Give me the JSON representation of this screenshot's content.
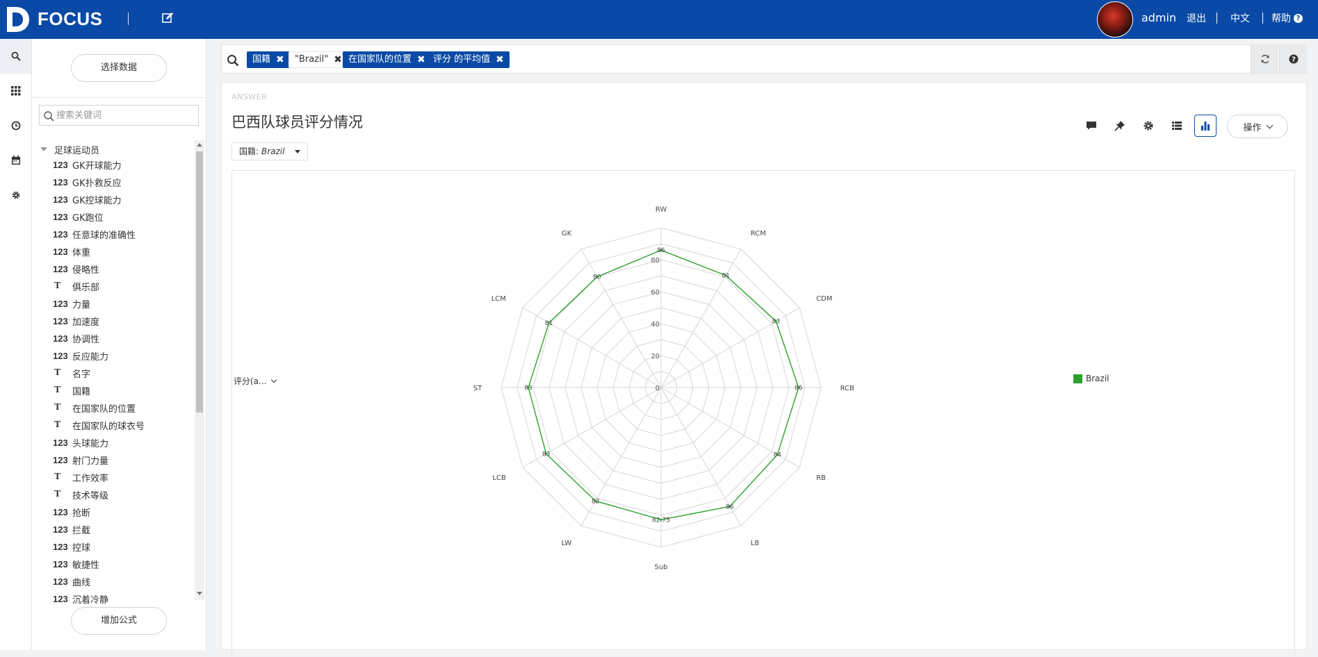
{
  "header": {
    "logo_text": "FOCUS",
    "user_name": "admin",
    "logout_label": "退出",
    "language_label": "中文",
    "help_label": "帮助",
    "help_glyph": "?"
  },
  "rail": {
    "items": [
      {
        "name": "search-icon",
        "active": true
      },
      {
        "name": "apps-icon",
        "active": false
      },
      {
        "name": "history-icon",
        "active": false
      },
      {
        "name": "calendar-icon",
        "active": false
      },
      {
        "name": "gear-icon",
        "active": false
      }
    ]
  },
  "data_panel": {
    "select_data_label": "选择数据",
    "search_placeholder": "搜索关键词",
    "table_name": "足球运动员",
    "fields": [
      {
        "type": "123",
        "name": "GK开球能力"
      },
      {
        "type": "123",
        "name": "GK扑救反应"
      },
      {
        "type": "123",
        "name": "GK控球能力"
      },
      {
        "type": "123",
        "name": "GK跑位"
      },
      {
        "type": "123",
        "name": "任意球的准确性"
      },
      {
        "type": "123",
        "name": "体重"
      },
      {
        "type": "123",
        "name": "侵略性"
      },
      {
        "type": "T",
        "name": "俱乐部"
      },
      {
        "type": "123",
        "name": "力量"
      },
      {
        "type": "123",
        "name": "加速度"
      },
      {
        "type": "123",
        "name": "协调性"
      },
      {
        "type": "123",
        "name": "反应能力"
      },
      {
        "type": "T",
        "name": "名字"
      },
      {
        "type": "T",
        "name": "国籍"
      },
      {
        "type": "T",
        "name": "在国家队的位置"
      },
      {
        "type": "T",
        "name": "在国家队的球衣号"
      },
      {
        "type": "123",
        "name": "头球能力"
      },
      {
        "type": "123",
        "name": "射门力量"
      },
      {
        "type": "T",
        "name": "工作效率"
      },
      {
        "type": "T",
        "name": "技术等级"
      },
      {
        "type": "123",
        "name": "抢断"
      },
      {
        "type": "123",
        "name": "拦截"
      },
      {
        "type": "123",
        "name": "控球"
      },
      {
        "type": "123",
        "name": "敏捷性"
      },
      {
        "type": "123",
        "name": "曲线"
      },
      {
        "type": "123",
        "name": "沉着冷静"
      }
    ],
    "add_formula_label": "增加公式"
  },
  "search_bar": {
    "tokens": [
      {
        "label": "国籍",
        "style": "blue"
      },
      {
        "label": "\"Brazil\"",
        "style": "plain"
      },
      {
        "label": "在国家队的位置",
        "style": "blue"
      },
      {
        "label": "评分 的平均值",
        "style": "blue"
      }
    ],
    "remove_glyph": "✖"
  },
  "answer": {
    "section_label": "ANSWER",
    "title": "巴西队球员评分情况",
    "filter": {
      "key": "国籍: ",
      "value": "Brazil"
    },
    "toolbar": [
      {
        "name": "comment-icon"
      },
      {
        "name": "pin-icon"
      },
      {
        "name": "settings-icon"
      },
      {
        "name": "table-view-icon"
      },
      {
        "name": "chart-view-icon",
        "active": true
      }
    ],
    "ops_label": "操作",
    "measure_selector": "评分(a...",
    "legend_label": "Brazil"
  },
  "chart_data": {
    "type": "radar",
    "title": "",
    "axes": [
      "RW",
      "RCM",
      "CDM",
      "RCB",
      "RB",
      "LB",
      "Sub",
      "LW",
      "LCB",
      "ST",
      "LCM",
      "GK"
    ],
    "radial_range": [
      0,
      100
    ],
    "radial_ticks": [
      0,
      20,
      40,
      60,
      80
    ],
    "grid": true,
    "series": [
      {
        "name": "Brazil",
        "color": "#2ca02c",
        "values": [
          86,
          81,
          83,
          86,
          84,
          86,
          82.75,
          82,
          83,
          83,
          81,
          80
        ],
        "labels": [
          "86",
          "81",
          "83",
          "86",
          "84",
          "86",
          "82.75",
          "82",
          "83",
          "83",
          "81",
          "80"
        ]
      }
    ],
    "legend": "right"
  }
}
